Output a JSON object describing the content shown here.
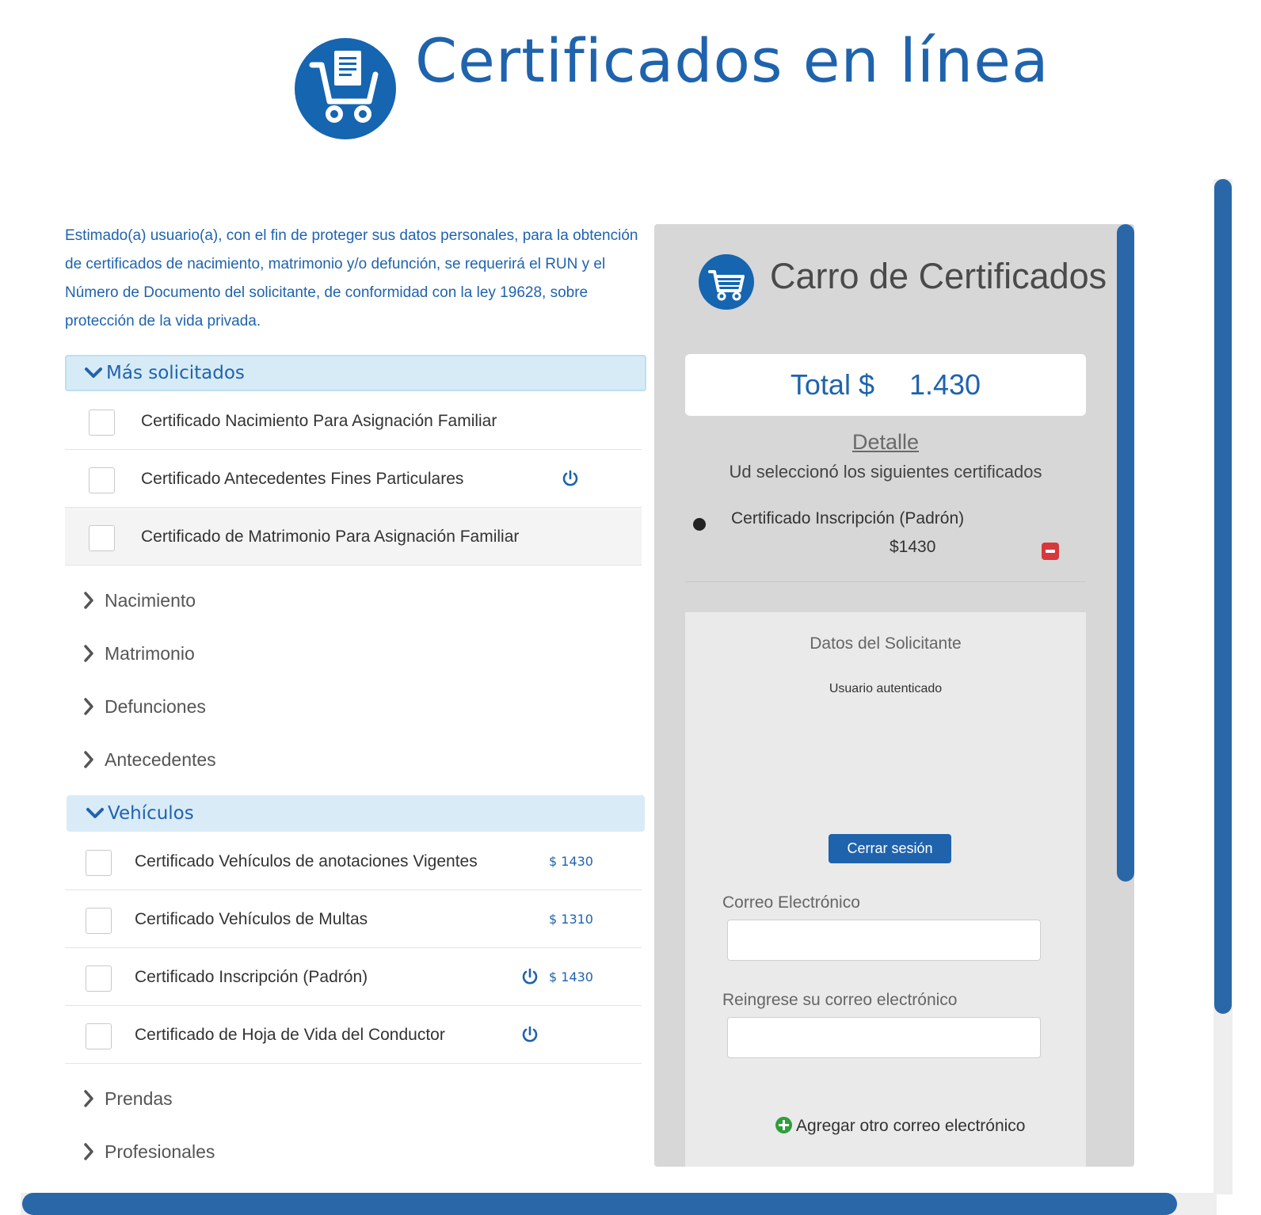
{
  "header": {
    "title": "Certificados en línea",
    "logo_icon": "shopping-cart-document-icon"
  },
  "intro_text": "Estimado(a) usuario(a), con el fin de proteger sus datos personales, para la obtención de certificados de nacimiento, matrimonio y/o defunción, se requerirá el RUN y el Número de Documento del solicitante, de conformidad con la ley 19628, sobre protección de la vida privada.",
  "sections": {
    "mas_solicitados": {
      "label": "Más solicitados",
      "items": [
        {
          "label": "Certificado Nacimiento Para Asignación Familiar",
          "checked": false
        },
        {
          "label": "Certificado Antecedentes Fines Particulares",
          "checked": false,
          "requires_login": true
        },
        {
          "label": "Certificado de Matrimonio Para Asignación Familiar",
          "checked": false
        }
      ]
    },
    "categories_top": [
      "Nacimiento",
      "Matrimonio",
      "Defunciones",
      "Antecedentes"
    ],
    "vehiculos": {
      "label": "Vehículos",
      "items": [
        {
          "label": "Certificado Vehículos de anotaciones Vigentes",
          "price": "$ 1430",
          "checked": false
        },
        {
          "label": "Certificado Vehículos de Multas",
          "price": "$ 1310",
          "checked": false
        },
        {
          "label": "Certificado Inscripción (Padrón)",
          "price": "$ 1430",
          "checked": false,
          "requires_login": true
        },
        {
          "label": "Certificado de Hoja de Vida del Conductor",
          "price": "",
          "checked": false,
          "requires_login": true
        }
      ]
    },
    "categories_bottom": [
      "Prendas",
      "Profesionales"
    ]
  },
  "cart": {
    "title": "Carro de Certificados",
    "total_label": "Total $",
    "total_value": "1.430",
    "detail_title": "Detalle",
    "detail_subtitle": "Ud seleccionó los siguientes certificados",
    "items": [
      {
        "name": "Certificado Inscripción (Padrón)",
        "price": "$1430"
      }
    ],
    "applicant": {
      "title": "Datos del Solicitante",
      "status": "Usuario autenticado",
      "logout_label": "Cerrar sesión",
      "email_label": "Correo Electrónico",
      "email_value": "",
      "email_confirm_label": "Reingrese su correo electrónico",
      "email_confirm_value": "",
      "add_email_label": "Agregar otro correo electrónico"
    }
  },
  "colors": {
    "brand_blue": "#1f63ad",
    "section_bg": "#d7ebf6",
    "cart_bg": "#d7d7d7",
    "remove_red": "#d7383b",
    "add_green": "#2e9e3a",
    "scrollbar": "#2a67a8"
  }
}
